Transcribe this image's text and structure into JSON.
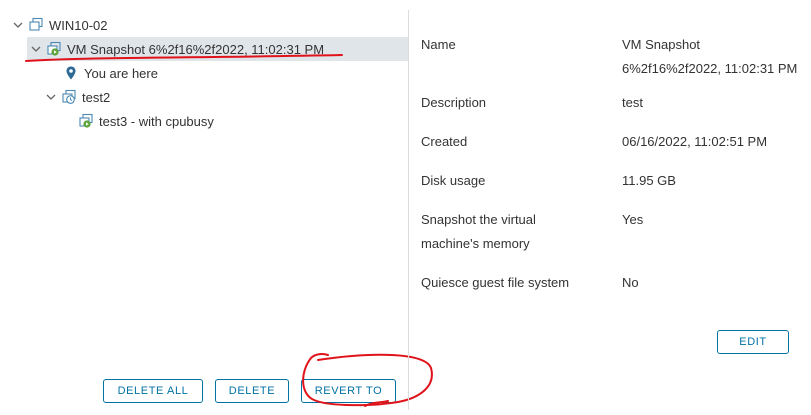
{
  "tree": {
    "root": {
      "label": "WIN10-02",
      "icon": "vm-icon"
    },
    "snapshot_selected": {
      "label": "VM Snapshot 6%2f16%2f2022, 11:02:31 PM",
      "icon": "snapshot-current-icon"
    },
    "you_are_here": {
      "label": "You are here",
      "icon": "location-pin-icon"
    },
    "test2": {
      "label": "test2",
      "icon": "snapshot-clock-icon"
    },
    "test3": {
      "label": "test3 - with cpubusy",
      "icon": "snapshot-run-icon"
    }
  },
  "buttons": {
    "delete_all": "DELETE ALL",
    "delete": "DELETE",
    "revert_to": "REVERT TO",
    "edit": "EDIT"
  },
  "details": {
    "name_label": "Name",
    "name_value_line1": "VM Snapshot",
    "name_value_line2": "6%2f16%2f2022, 11:02:31 PM",
    "description_label": "Description",
    "description_value": "test",
    "created_label": "Created",
    "created_value": "06/16/2022, 11:02:51 PM",
    "disk_usage_label": "Disk usage",
    "disk_usage_value": "11.95 GB",
    "memory_label_line1": "Snapshot the virtual",
    "memory_label_line2": "machine's memory",
    "memory_value": "Yes",
    "quiesce_label": "Quiesce guest file system",
    "quiesce_value": "No"
  },
  "colors": {
    "accent": "#0072a3",
    "selected_row": "#e0e5ea",
    "annotation": "#e0131b"
  }
}
